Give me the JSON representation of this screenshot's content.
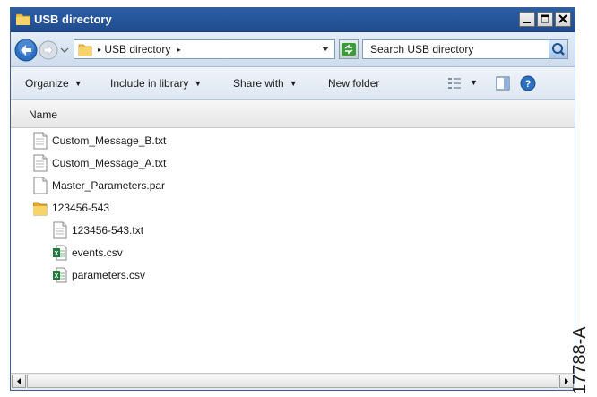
{
  "window": {
    "title": "USB directory",
    "address_crumb": "USB directory",
    "search_placeholder": "Search USB directory"
  },
  "toolbar": {
    "organize": "Organize",
    "include_in_library": "Include in library",
    "share_with": "Share with",
    "new_folder": "New folder"
  },
  "columns": {
    "name": "Name"
  },
  "files": [
    {
      "name": "Custom_Message_B.txt",
      "icon": "text-file-icon",
      "indent": 0
    },
    {
      "name": "Custom_Message_A.txt",
      "icon": "text-file-icon",
      "indent": 0
    },
    {
      "name": "Master_Parameters.par",
      "icon": "blank-file-icon",
      "indent": 0
    },
    {
      "name": "123456-543",
      "icon": "folder-icon",
      "indent": 0
    },
    {
      "name": "123456-543.txt",
      "icon": "text-file-icon",
      "indent": 1
    },
    {
      "name": "events.csv",
      "icon": "excel-csv-icon",
      "indent": 1
    },
    {
      "name": "parameters.csv",
      "icon": "excel-csv-icon",
      "indent": 1
    }
  ],
  "figure_label": "17788-A",
  "colors": {
    "titlebar": "#2b5ea6",
    "folder": "#f0c24a",
    "excel": "#1f7a3a"
  }
}
